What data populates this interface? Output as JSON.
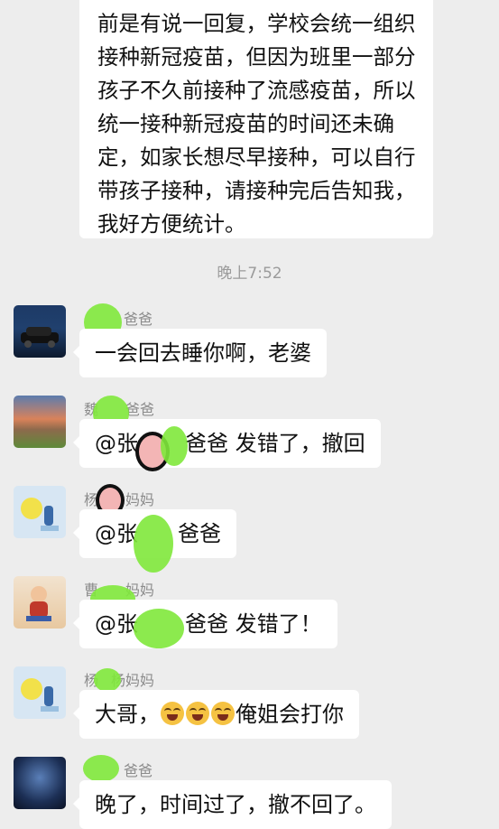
{
  "top_message": {
    "lines": [
      "前是有说一回复，学校会统一组织",
      "接种新冠疫苗，但因为班里一部分",
      "孩子不久前接种了流感疫苗，所以",
      "统一接种新冠疫苗的时间还未确",
      "定，如家长想尽早接种，可以自行",
      "带孩子接种，请接种完后告知我，",
      "我好方便统计。"
    ]
  },
  "timestamp": "晚上7:52",
  "messages": [
    {
      "sender": "爸爸",
      "sender_prefix": "",
      "text": "一会回去睡你啊，老婆",
      "avatar": "car-avatar"
    },
    {
      "sender": "爸爸",
      "sender_prefix": "魏",
      "text_prefix": "@张",
      "text_suffix": "爸爸  发错了，撤回",
      "avatar": "sunset-avatar"
    },
    {
      "sender": "妈妈",
      "sender_prefix": "杨",
      "text_prefix": "@张",
      "text_suffix": "爸爸",
      "avatar": "cartoon-avatar"
    },
    {
      "sender": "妈妈",
      "sender_prefix": "曹",
      "text_prefix": "@张",
      "text_suffix": "爸爸  发错了！",
      "avatar": "child-avatar"
    },
    {
      "sender": "杨妈妈",
      "sender_prefix": "杨",
      "text_prefix": "大哥，",
      "text_suffix": "俺姐会打你",
      "avatar": "cartoon-avatar"
    },
    {
      "sender": "爸爸",
      "sender_prefix": "",
      "text": "晚了，时间过了，撤不回了。",
      "avatar": "galaxy-avatar"
    }
  ],
  "emoji_name": "laughing-crying-emoji",
  "colors": {
    "background": "#ededed",
    "bubble": "#ffffff",
    "redaction": "#7fe83b"
  }
}
